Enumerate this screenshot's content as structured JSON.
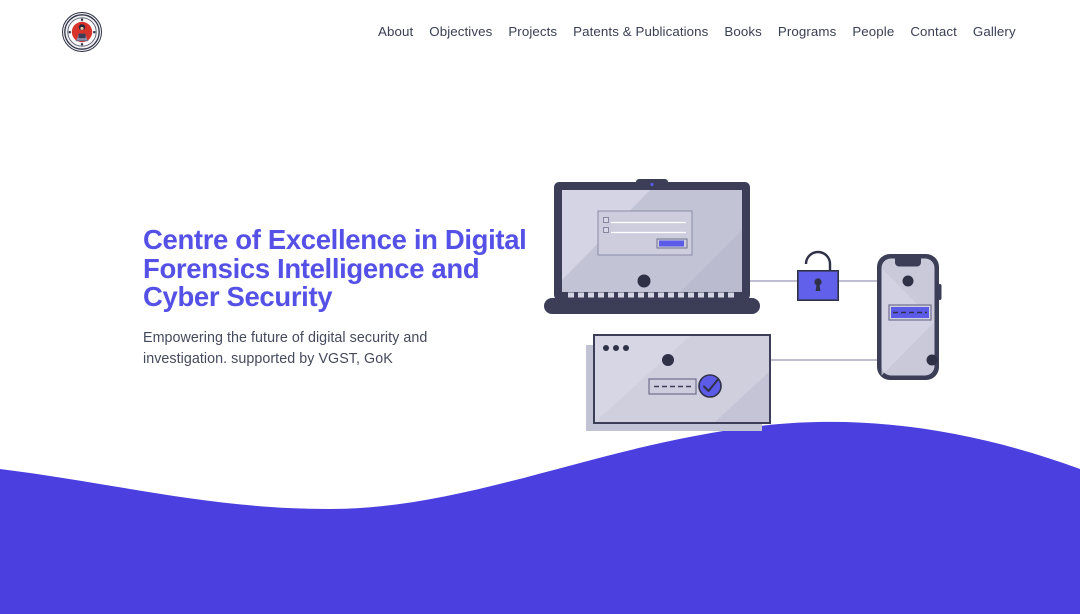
{
  "header": {
    "logo": {
      "icon": "shield-seal-logo",
      "alt": "Centre of Excellence emblem"
    },
    "nav": [
      {
        "label": "About",
        "name": "nav-item-about"
      },
      {
        "label": "Objectives",
        "name": "nav-item-objectives"
      },
      {
        "label": "Projects",
        "name": "nav-item-projects"
      },
      {
        "label": "Patents & Publications",
        "name": "nav-item-patents-publications"
      },
      {
        "label": "Books",
        "name": "nav-item-books"
      },
      {
        "label": "Programs",
        "name": "nav-item-programs"
      },
      {
        "label": "People",
        "name": "nav-item-people"
      },
      {
        "label": "Contact",
        "name": "nav-item-contact"
      },
      {
        "label": "Gallery",
        "name": "nav-item-gallery"
      }
    ]
  },
  "hero": {
    "title": "Centre of Excellence in Digital Forensics Intelligence and Cyber Security",
    "subtitle": "Empowering the future of digital security and investigation. supported by VGST, GoK"
  },
  "illustration": {
    "name": "cyber-security-devices-illustration",
    "elements": [
      "laptop-with-login-form",
      "padlock-icon",
      "smartphone-with-passcode-field",
      "browser-window-with-verified-badge",
      "connection-line-top",
      "connection-line-bottom"
    ]
  },
  "colors": {
    "brand_indigo": "#5551e6",
    "wave_blue": "#4b40df",
    "nav_text": "#3a4055",
    "body_text": "#454a5c",
    "device_dark": "#3c3e58",
    "device_screen": "#c3c3d6",
    "device_screen_light": "#d4d4e4",
    "accent_blue": "#5b5be8",
    "logo_red": "#d8332a",
    "background": "#ffffff"
  }
}
